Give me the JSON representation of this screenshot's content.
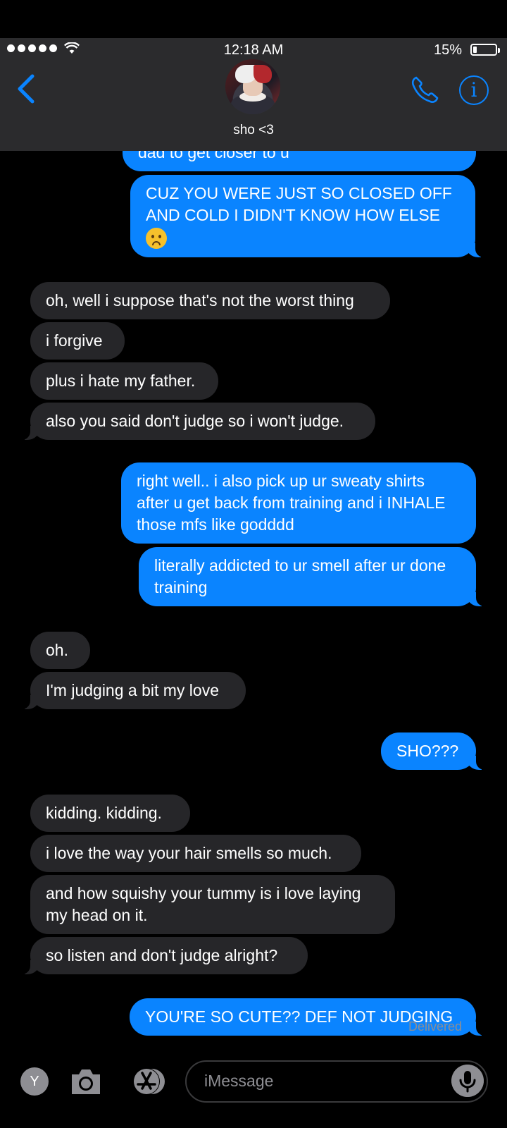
{
  "status": {
    "time": "12:18 AM",
    "battery": "15%",
    "battery_level": 0.15
  },
  "header": {
    "contact_name": "sho <3"
  },
  "messages": [
    {
      "from": "me",
      "text": "dad to get closer to u"
    },
    {
      "from": "me",
      "text": "CUZ YOU WERE JUST SO CLOSED OFF AND COLD I DIDN'T KNOW HOW ELSE",
      "emoji": "frowning-face"
    },
    {
      "from": "them",
      "text": "oh, well i suppose that's not the worst thing"
    },
    {
      "from": "them",
      "text": "i forgive"
    },
    {
      "from": "them",
      "text": "plus i hate my father."
    },
    {
      "from": "them",
      "text": "also you said don't judge so i won't judge."
    },
    {
      "from": "me",
      "text": "right well.. i also pick up ur sweaty shirts after u get back from training and i INHALE those mfs like godddd"
    },
    {
      "from": "me",
      "text": "literally addicted to ur smell after ur done training"
    },
    {
      "from": "them",
      "text": "oh."
    },
    {
      "from": "them",
      "text": "I'm judging a bit my love"
    },
    {
      "from": "me",
      "text": "SHO???"
    },
    {
      "from": "them",
      "text": "kidding. kidding."
    },
    {
      "from": "them",
      "text": "i love the way your hair smells so much."
    },
    {
      "from": "them",
      "text": "and how squishy your tummy is i love laying my head on it."
    },
    {
      "from": "them",
      "text": "so listen and don't judge alright?"
    },
    {
      "from": "me",
      "text": "YOU'RE SO CUTE?? DEF NOT JUDGING"
    }
  ],
  "delivered": "Delivered",
  "composer": {
    "app_badge": "Y",
    "placeholder": "iMessage"
  },
  "colors": {
    "sent_bubble": "#0a84ff",
    "received_bubble": "#262629",
    "accent": "#0a84ff"
  }
}
